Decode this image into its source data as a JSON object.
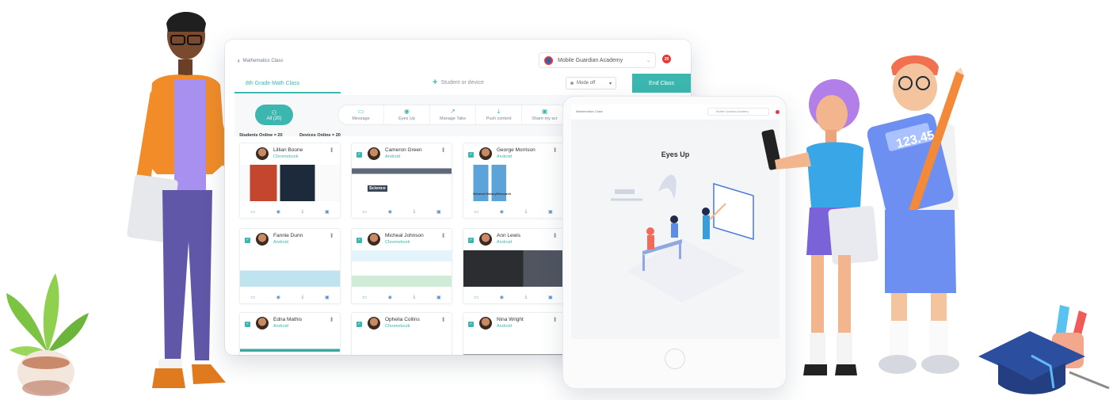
{
  "dashboard": {
    "back_label": "Mathematics Class",
    "org_name": "Mobile Guardian Academy",
    "notif_count": "20",
    "class_tab": "8th Grade Math Class",
    "add_label": "Student or device",
    "mode_label": "Mode off",
    "end_class": "End Class",
    "all_label": "All (20)",
    "tools": [
      "Message",
      "Eyes Up",
      "Manage Tabs",
      "Push content",
      "Share my scr"
    ],
    "students_online": "Students Online = 20",
    "devices_online": "Devices Online = 20"
  },
  "students": [
    {
      "name": "Lillian Boone",
      "device": "Chromebook"
    },
    {
      "name": "Cameron Green",
      "device": "Android"
    },
    {
      "name": "George Morrison",
      "device": "Android"
    },
    {
      "name": "Fannie Dunn",
      "device": "Android"
    },
    {
      "name": "Micheal Johnson",
      "device": "Chromebook"
    },
    {
      "name": "Ann Lewis",
      "device": "Android"
    },
    {
      "name": "Edna Mathis",
      "device": "Android"
    },
    {
      "name": "Ophelia Collins",
      "device": "Chromebook"
    },
    {
      "name": "Nina Wright",
      "device": "Android"
    }
  ],
  "screenshot_text": {
    "science": "Science",
    "general_history": "General History",
    "research": "Research"
  },
  "tablet": {
    "title": "Mathematics Class",
    "org_name": "Mobile Guardian Academy",
    "heading": "Eyes Up"
  },
  "decor": {
    "calculator_display": "123.45"
  },
  "colors": {
    "accent": "#3bb7b0",
    "alert": "#e53935",
    "link": "#5b8fc9"
  }
}
